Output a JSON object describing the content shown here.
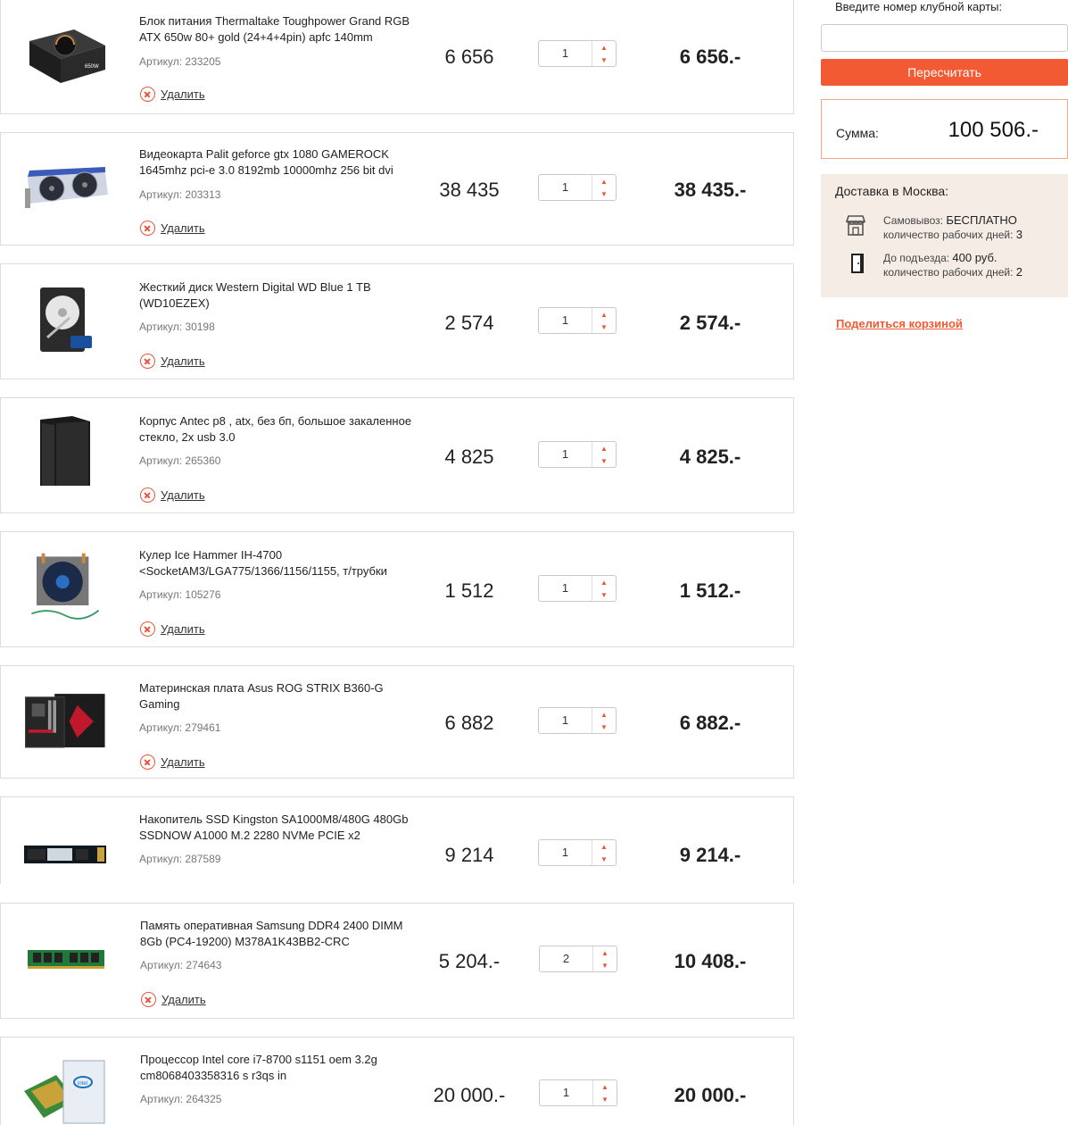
{
  "cart": {
    "delete_label": "Удалить",
    "items": [
      {
        "name": "Блок питания Thermaltake Toughpower Grand RGB ATX 650w 80+ gold (24+4+4pin) apfc 140mm",
        "sku": "Артикул: 233205",
        "price": "6 656",
        "qty": "1",
        "total": "6 656.-",
        "thumb": "psu-image"
      },
      {
        "name": "Видеокарта Palit geforce gtx 1080 GAMEROCK 1645mhz pci-e 3.0 8192mb 10000mhz 256 bit dvi",
        "sku": "Артикул: 203313",
        "price": "38 435",
        "qty": "1",
        "total": "38 435.-",
        "thumb": "gpu-image"
      },
      {
        "name": "Жесткий диск Western Digital WD Blue 1 TB (WD10EZEX)",
        "sku": "Артикул: 30198",
        "price": "2 574",
        "qty": "1",
        "total": "2 574.-",
        "thumb": "hdd-image"
      },
      {
        "name": "Корпус Antec p8 , atx, без бп, большое закаленное стекло, 2x usb 3.0",
        "sku": "Артикул: 265360",
        "price": "4 825",
        "qty": "1",
        "total": "4 825.-",
        "thumb": "case-image"
      },
      {
        "name": "Кулер Ice Hammer IH-4700 <SocketAM3/LGA775/1366/1156/1155, т/трубки",
        "sku": "Артикул: 105276",
        "price": "1 512",
        "qty": "1",
        "total": "1 512.-",
        "thumb": "cooler-image"
      },
      {
        "name": "Материнская плата Asus ROG STRIX B360-G Gaming",
        "sku": "Артикул: 279461",
        "price": "6 882",
        "qty": "1",
        "total": "6 882.-",
        "thumb": "motherboard-image"
      },
      {
        "name": "Накопитель SSD Kingston SA1000M8/480G 480Gb SSDNOW A1000 M.2 2280 NVMe PCIE x2",
        "sku": "Артикул: 287589",
        "price": "9 214",
        "qty": "1",
        "total": "9 214.-",
        "thumb": "ssd-image"
      },
      {
        "name": "Память оперативная Samsung DDR4 2400 DIMM 8Gb (PC4-19200) M378A1K43BB2-CRC",
        "sku": "Артикул: 274643",
        "price": "5 204.-",
        "qty": "2",
        "total": "10 408.-",
        "thumb": "ram-image"
      },
      {
        "name": "Процессор Intel core i7-8700 s1151 oem 3.2g cm8068403358316 s r3qs in",
        "sku": "Артикул: 264325",
        "price": "20 000.-",
        "qty": "1",
        "total": "20 000.-",
        "thumb": "cpu-image"
      }
    ]
  },
  "side": {
    "club_label": "Введите номер клубной карты:",
    "club_value": "",
    "recalc_label": "Пересчитать",
    "sum_label": "Сумма:",
    "sum_value": "100 506.-",
    "delivery_title_prefix": "Доставка в ",
    "delivery_city": "Москва",
    "delivery_title_suffix": ":",
    "pickup_label": "Самовывоз: ",
    "pickup_value": "БЕСПЛАТНО",
    "pickup_days_label": "количество рабочих дней: ",
    "pickup_days": "3",
    "door_label": "До подъезда: ",
    "door_value": "400 руб.",
    "door_days_label": "количество рабочих дней: ",
    "door_days": "2",
    "share_label": "Поделиться корзиной"
  },
  "colors": {
    "accent": "#f25a34",
    "delivery_bg": "#f5ece6",
    "border": "#dcdcdc"
  }
}
